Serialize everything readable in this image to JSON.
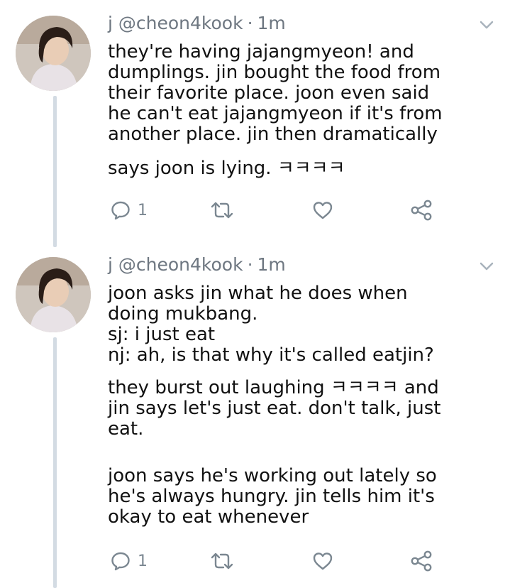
{
  "tweets": [
    {
      "author_name": "j",
      "handle": "@cheon4kook",
      "separator": "·",
      "time": "1m",
      "paragraphs": [
        "they're having jajangmyeon! and\ndumplings. jin bought the food from\ntheir favorite place. joon even said\nhe can't eat jajangmyeon if it's from\nanother place. jin then dramatically",
        "says joon is lying. ㅋㅋㅋㅋ"
      ],
      "reply_count": "1"
    },
    {
      "author_name": "j",
      "handle": "@cheon4kook",
      "separator": "·",
      "time": "1m",
      "paragraphs": [
        "joon asks jin what he does when\ndoing mukbang.\nsj: i just eat\nnj: ah, is that why it's called eatjin?",
        "they burst out laughing ㅋㅋㅋㅋ and\njin says let's just eat. don't talk, just\neat.",
        "joon says he's working out lately so\nhe's always hungry. jin tells him it's\nokay to eat whenever"
      ],
      "reply_count": "1"
    }
  ],
  "icons": {
    "reply": "reply-icon",
    "retweet": "retweet-icon",
    "like": "heart-icon",
    "share": "share-icon",
    "menu": "chevron-down-icon"
  },
  "colors": {
    "text": "#111111",
    "muted": "#6e7781",
    "thread_line": "#d3dbe3",
    "icon": "#7b8791"
  }
}
